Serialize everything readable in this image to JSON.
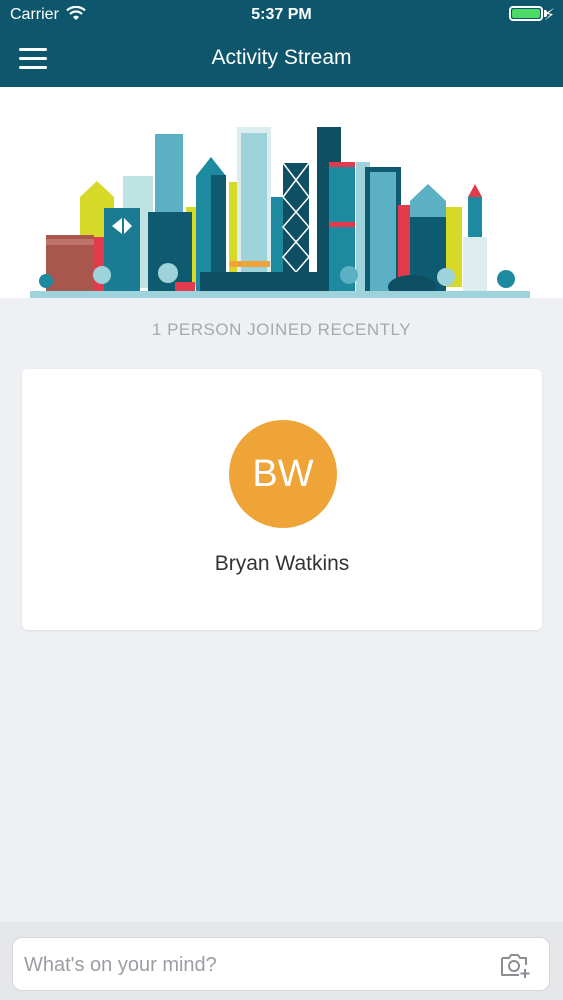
{
  "status_bar": {
    "carrier": "Carrier",
    "time": "5:37 PM",
    "battery_level": 1.0,
    "icons": [
      "wifi-icon",
      "battery-icon",
      "charging-icon"
    ]
  },
  "nav": {
    "title": "Activity Stream",
    "menu_icon": "hamburger-menu-icon"
  },
  "section": {
    "title": "1 PERSON JOINED RECENTLY"
  },
  "people": [
    {
      "initials": "BW",
      "name": "Bryan Watkins",
      "avatar_color": "#efa437"
    }
  ],
  "composer": {
    "placeholder": "What's on your mind?",
    "camera_icon": "camera-add-icon"
  },
  "colors": {
    "header": "#0e566c",
    "background": "#eef0f3",
    "avatar": "#efa437"
  }
}
